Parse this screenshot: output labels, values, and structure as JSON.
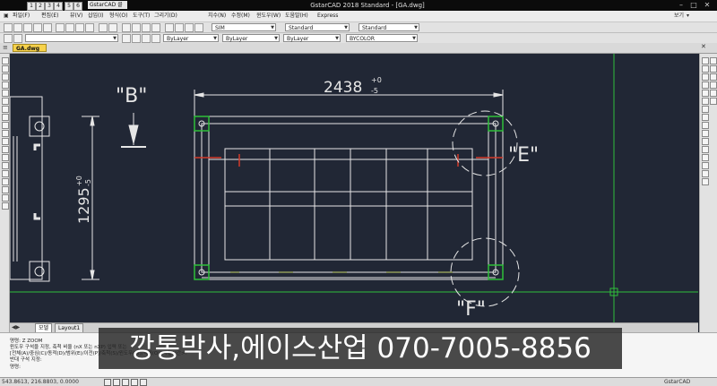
{
  "window": {
    "title": "GstarCAD 2018 Standard - [GA.dwg]",
    "workspace": "GstarCAD 클래식",
    "quick_access": [
      "1",
      "2",
      "3",
      "4",
      "5",
      "6",
      "7"
    ]
  },
  "menu": {
    "items": [
      "파일(F)",
      "편집(E)",
      "뷰(V)",
      "삽입(I)",
      "형식(O)",
      "도구(T)",
      "그리기(D)",
      "치수(N)",
      "수정(M)",
      "윈도우(W)",
      "도움말(H)",
      "Express"
    ],
    "right": [
      "보기",
      "▾"
    ]
  },
  "toolbar": {
    "style_combo": "SIM",
    "text_style": "Standard",
    "dim_style": "Standard",
    "layer": "ByLayer",
    "linetype": "ByLayer",
    "lineweight": "ByLayer",
    "color": "BYCOLOR"
  },
  "file_tab": "GA.dwg",
  "drawing": {
    "label_b": "\"B\"",
    "label_e": "\"E\"",
    "label_f": "\"F\"",
    "dim_width": "2438",
    "dim_width_tol_plus": "+0",
    "dim_width_tol_minus": "-5",
    "dim_height": "1295",
    "dim_height_tol_plus": "+0",
    "dim_height_tol_minus": "-5"
  },
  "tabs": {
    "model": "모델",
    "layout": "Layout1"
  },
  "command": {
    "lines": [
      "명령: Z ZOOM",
      "윈도우 구석을 지정, 축척 비율 (nX 또는 nXP) 입력 또는",
      "[전체(A)/중심(C)/동적(D)/범위(E)/이전(P)/축척(S)/윈도우(W)/객체(O)] <실시간>:",
      "반대 구석 지정:",
      "명령:"
    ]
  },
  "status": {
    "coords": "543.8613, 216.8803, 0.0000",
    "brand": "GstarCAD"
  },
  "overlay": {
    "caption": "깡통박사,에이스산업 070-7005-8856"
  },
  "colors": {
    "canvas_bg": "#212735",
    "line_white": "#e6e6e6",
    "crosshair_green": "#2fbf3a",
    "accent_red": "#d23a2a",
    "tab_yellow": "#f7d24b"
  }
}
